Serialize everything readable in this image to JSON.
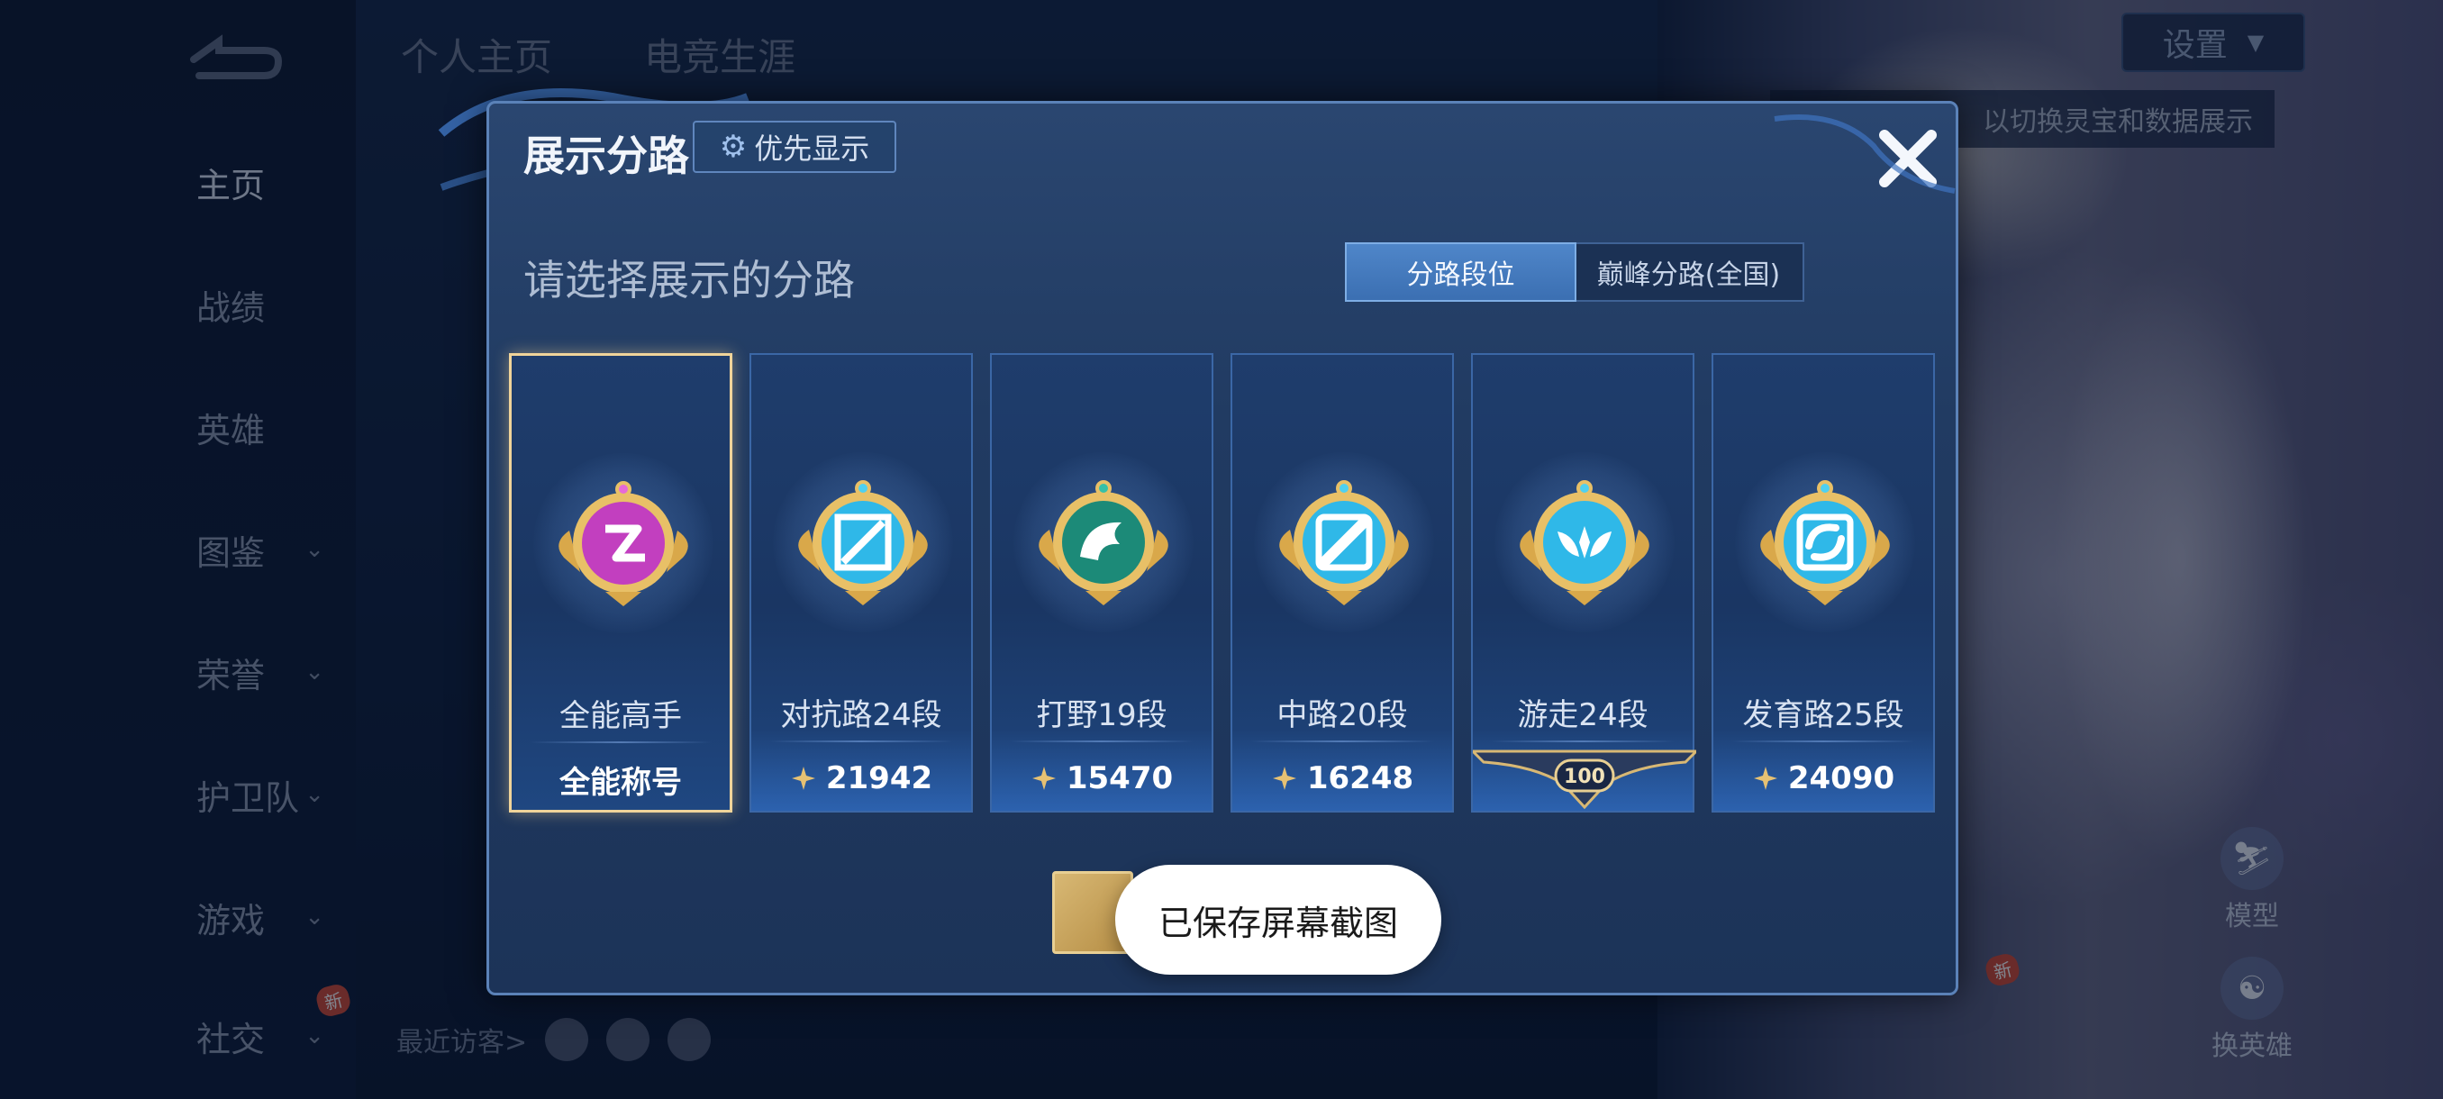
{
  "background": {
    "top_tabs": [
      "个人主页",
      "电竞生涯"
    ],
    "settings_label": "设置",
    "tip_text": "以切换灵宝和数据展示",
    "sidebar": {
      "items": [
        {
          "label": "主页",
          "has_chevron": false,
          "active": true
        },
        {
          "label": "战绩",
          "has_chevron": false
        },
        {
          "label": "英雄",
          "has_chevron": false
        },
        {
          "label": "图鉴",
          "has_chevron": true
        },
        {
          "label": "荣誉",
          "has_chevron": true
        },
        {
          "label": "护卫队",
          "has_chevron": true
        },
        {
          "label": "游戏",
          "has_chevron": true
        },
        {
          "label": "社交",
          "has_chevron": true,
          "badge": "新"
        }
      ]
    },
    "recent_visitors_label": "最近访客>",
    "right_tools": [
      {
        "label": "模型",
        "icon": "model-icon"
      },
      {
        "label": "换英雄",
        "icon": "switch-hero-icon",
        "badge": "新"
      }
    ]
  },
  "modal": {
    "title": "展示分路",
    "priority_label": "优先显示",
    "subtitle": "请选择展示的分路",
    "toggle": {
      "options": [
        "分路段位",
        "巅峰分路(全国)"
      ],
      "selected": "分路段位"
    },
    "lanes": [
      {
        "name": "全能高手",
        "stat": "全能称号",
        "selected": true,
        "emblem_color": "#c23fbf",
        "icon": "all-rounder-icon"
      },
      {
        "name": "对抗路24段",
        "stat": "21942",
        "emblem_color": "#2fb8e8",
        "icon": "clash-lane-icon"
      },
      {
        "name": "打野19段",
        "stat": "15470",
        "emblem_color": "#1c8a78",
        "icon": "jungle-icon"
      },
      {
        "name": "中路20段",
        "stat": "16248",
        "emblem_color": "#2fb8e8",
        "icon": "mid-lane-icon"
      },
      {
        "name": "游走24段",
        "stat": "100",
        "stat_style": "ribbon",
        "emblem_color": "#2fb8e8",
        "icon": "roam-icon"
      },
      {
        "name": "发育路25段",
        "stat": "24090",
        "emblem_color": "#2fb8e8",
        "icon": "farm-lane-icon"
      }
    ]
  },
  "toast": "已保存屏幕截图",
  "colors": {
    "modal_bg": "#213b62",
    "modal_border": "#5b82b8",
    "selected_border": "#f0d49a",
    "gold": "#d8b874"
  }
}
